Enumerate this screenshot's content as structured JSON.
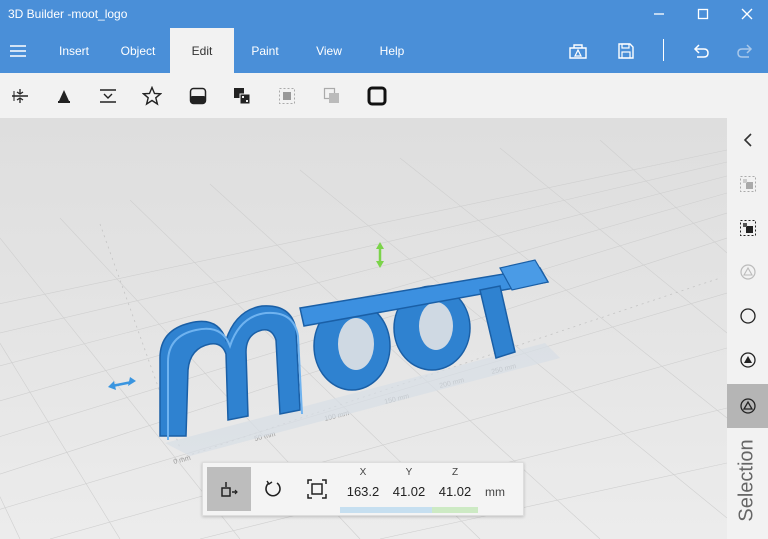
{
  "window": {
    "title": "3D Builder -moot_logo"
  },
  "menu": {
    "tabs": [
      {
        "label": "Insert"
      },
      {
        "label": "Object"
      },
      {
        "label": "Edit"
      },
      {
        "label": "Paint"
      },
      {
        "label": "View"
      },
      {
        "label": "Help"
      }
    ],
    "active_tab": "Edit"
  },
  "toolbar": {
    "icons": [
      "split-icon",
      "extrude-icon",
      "simplify-icon",
      "star-icon",
      "smooth-icon",
      "merge-icon",
      "select-icon",
      "subtract-icon",
      "outline-icon"
    ]
  },
  "viewport": {
    "object_text": "moot",
    "object_color": "#3b8fd9",
    "ruler_labels": [
      "0 mm",
      "50 mm",
      "100 mm",
      "150 mm",
      "200 mm",
      "250 mm"
    ]
  },
  "right_panel": {
    "label": "Selection"
  },
  "transform": {
    "x_label": "X",
    "y_label": "Y",
    "z_label": "Z",
    "x": "163.2",
    "y": "41.02",
    "z": "41.02",
    "unit": "mm"
  },
  "colors": {
    "accent": "#4a8fd8",
    "x_bar": "#c6dff0",
    "y_bar": "#c6dff0",
    "z_bar": "#cdeac4"
  }
}
